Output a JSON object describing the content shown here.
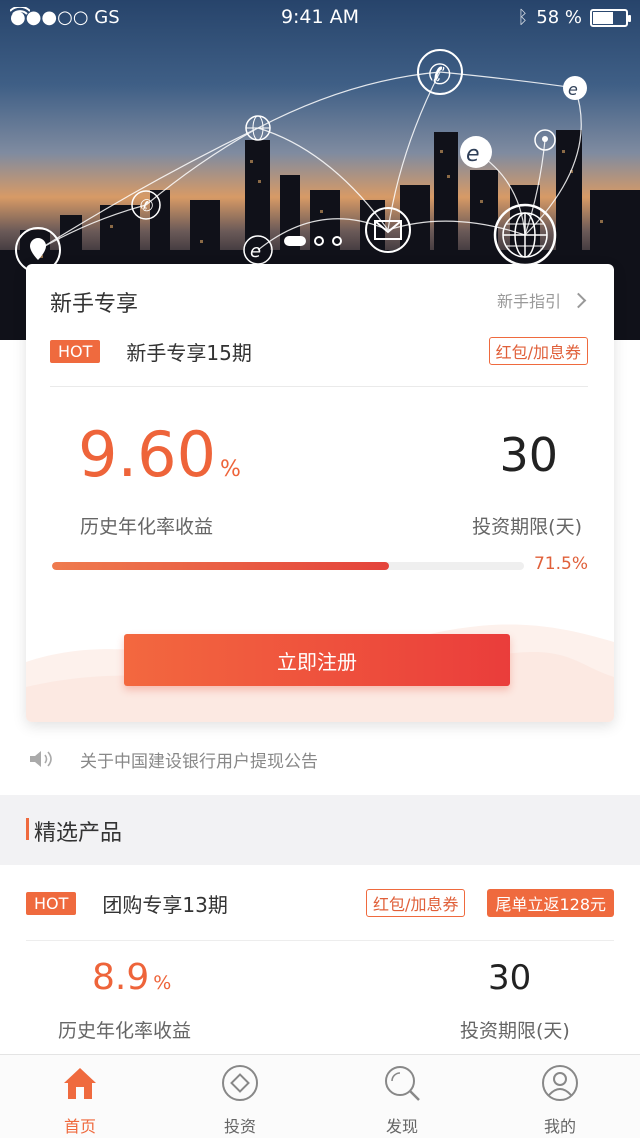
{
  "status_bar": {
    "carrier": "●●●○○ GS",
    "time": "9:41 AM",
    "battery": "58 %"
  },
  "newbie": {
    "title": "新手专享",
    "guide_link": "新手指引",
    "hot_badge": "HOT",
    "product_name": "新手专享15期",
    "tag": "红包/加息券",
    "rate": "9.60",
    "rate_unit": "%",
    "rate_label": "历史年化率收益",
    "term": "30",
    "term_label": "投资期限(天)",
    "progress": 0.715,
    "progress_text": "71.5%",
    "register_button": "立即注册"
  },
  "notice": {
    "text": "关于中国建设银行用户提现公告"
  },
  "featured": {
    "section_title": "精选产品",
    "hot_badge": "HOT",
    "product_name": "团购专享13期",
    "tag": "红包/加息券",
    "promo": "尾单立返128元",
    "rate": "8.9",
    "rate_unit": "%",
    "rate_label": "历史年化率收益",
    "term": "30",
    "term_label": "投资期限(天)"
  },
  "tabbar": {
    "home": "首页",
    "invest": "投资",
    "discover": "发现",
    "mine": "我的"
  },
  "colors": {
    "accent": "#ef6a3e",
    "accent_dark": "#ea3d3b"
  },
  "icons": [
    "location-icon",
    "phone-icon",
    "globe-icon",
    "mail-icon",
    "browser-e-icon",
    "speaker-icon",
    "home-icon",
    "invest-icon",
    "search-icon",
    "user-icon"
  ]
}
